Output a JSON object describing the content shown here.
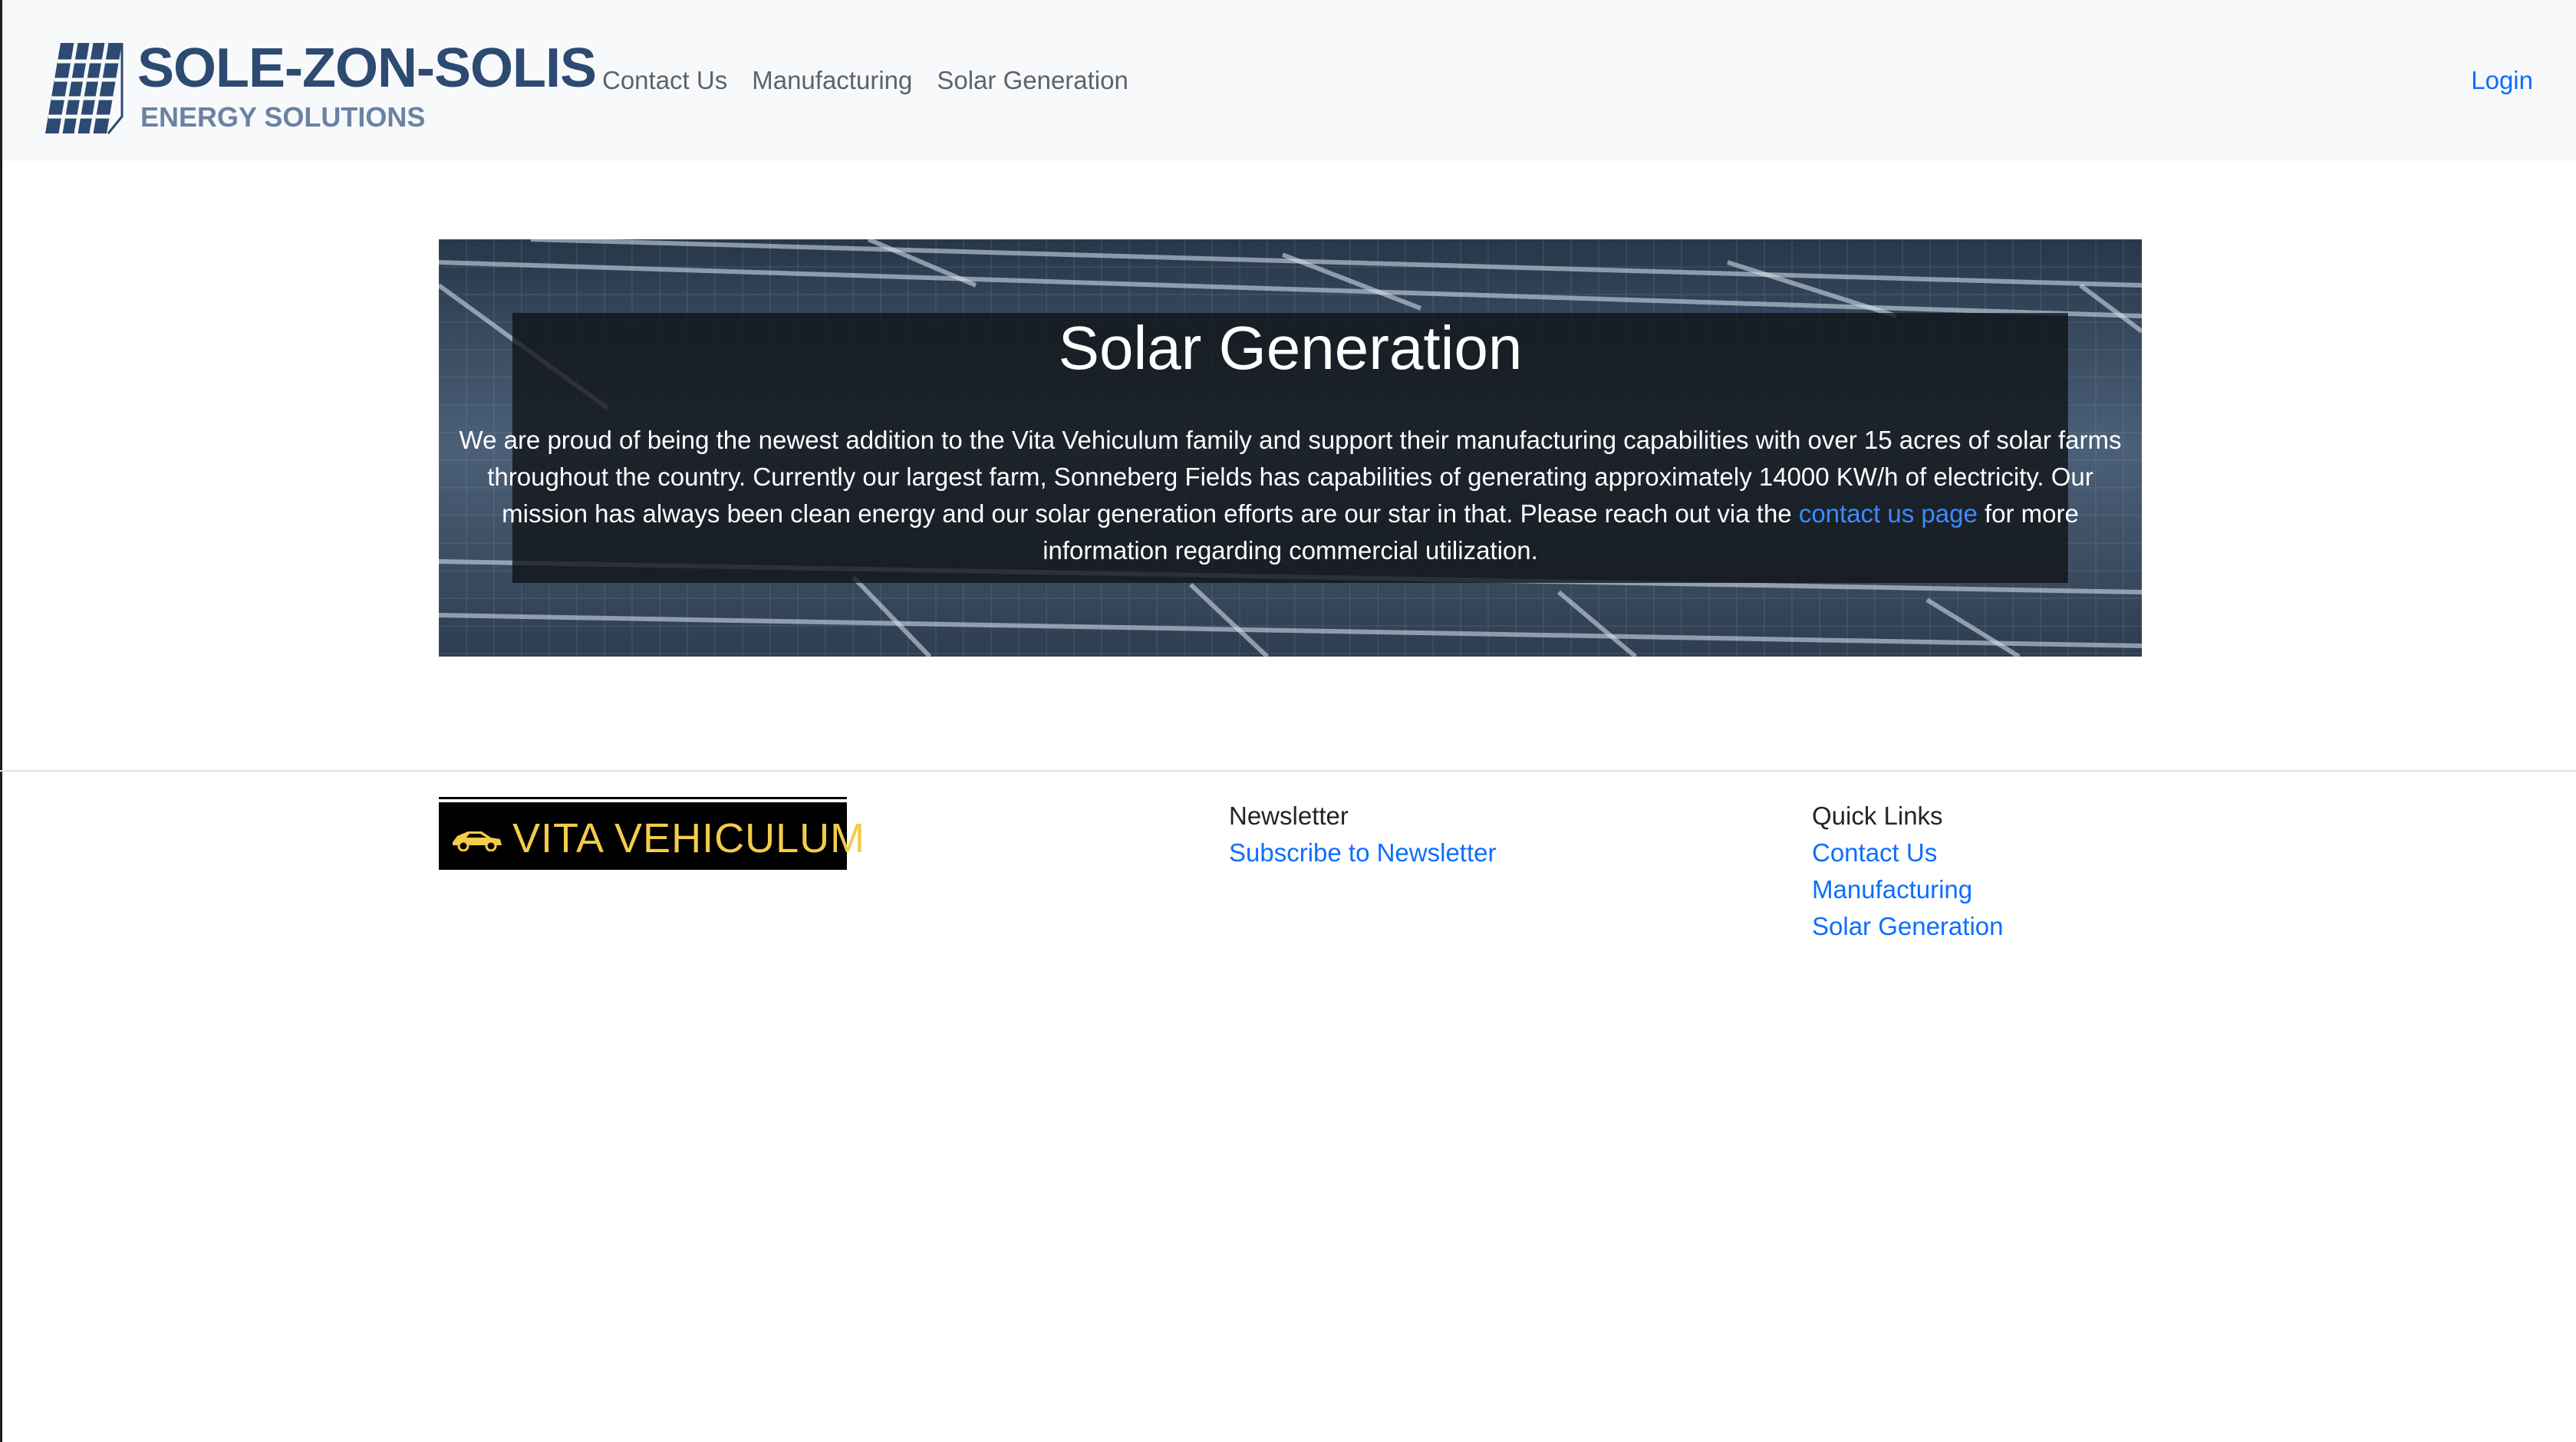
{
  "brand": {
    "name": "SOLE-ZON-SOLIS",
    "tagline": "ENERGY SOLUTIONS",
    "logo_icon": "solar-panel-icon"
  },
  "nav": {
    "links": [
      "Contact Us",
      "Manufacturing",
      "Solar Generation"
    ],
    "login": "Login"
  },
  "hero": {
    "background": "solar-panels-photo",
    "title": "Solar Generation",
    "text_before": "We are proud of being the newest addition to the Vita Vehiculum family and support their manufacturing capabilities with over 15 acres of solar farms throughout the country. Currently our largest farm, Sonneberg Fields has capabilities of generating approximately 14000 KW/h of electricity. Our mission has always been clean energy and our solar generation efforts are our star in that. Please reach out via the ",
    "link_text": "contact us page",
    "text_after": " for more information regarding commercial utilization."
  },
  "footer": {
    "partner_logo_text": "VITA VEHICULUM",
    "partner_logo_icon": "car-icon",
    "newsletter": {
      "heading": "Newsletter",
      "link": "Subscribe to Newsletter"
    },
    "quick_links": {
      "heading": "Quick Links",
      "links": [
        "Contact Us",
        "Manufacturing",
        "Solar Generation"
      ]
    }
  },
  "colors": {
    "brand": "#2c4a72",
    "link": "#0d6efd",
    "logo_yellow": "#f2cc4a"
  }
}
